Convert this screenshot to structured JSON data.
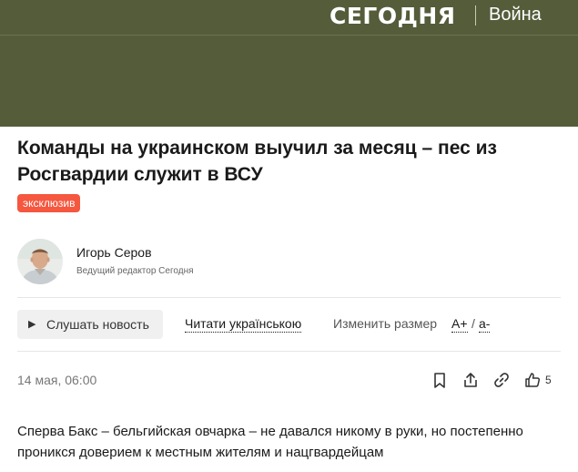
{
  "header": {
    "logo": "СЕГОДНЯ",
    "section": "Война"
  },
  "article": {
    "title": "Команды на украинском выучил за месяц – пес из Росгвардии служит в ВСУ",
    "tag": "эксклюзив",
    "date": "14 мая, 06:00",
    "body": "Сперва Бакс – бельгийская овчарка – не давался никому в руки, но постепенно проникся доверием к местным жителям и нацгвардейцам"
  },
  "author": {
    "name": "Игорь Серов",
    "role": "Ведущий редактор Сегодня"
  },
  "toolbar": {
    "listen_label": "Слушать новость",
    "ukr_link": "Читати українською",
    "size_label": "Изменить размер",
    "size_plus": "A+",
    "size_slash": "/",
    "size_minus": "a-"
  },
  "actions": {
    "icons": [
      "bookmark-icon",
      "share-icon",
      "link-icon",
      "thumbs-up-icon"
    ],
    "like_count": "5"
  },
  "colors": {
    "header_bg": "#545c3a",
    "tag_bg": "#f5573f"
  }
}
